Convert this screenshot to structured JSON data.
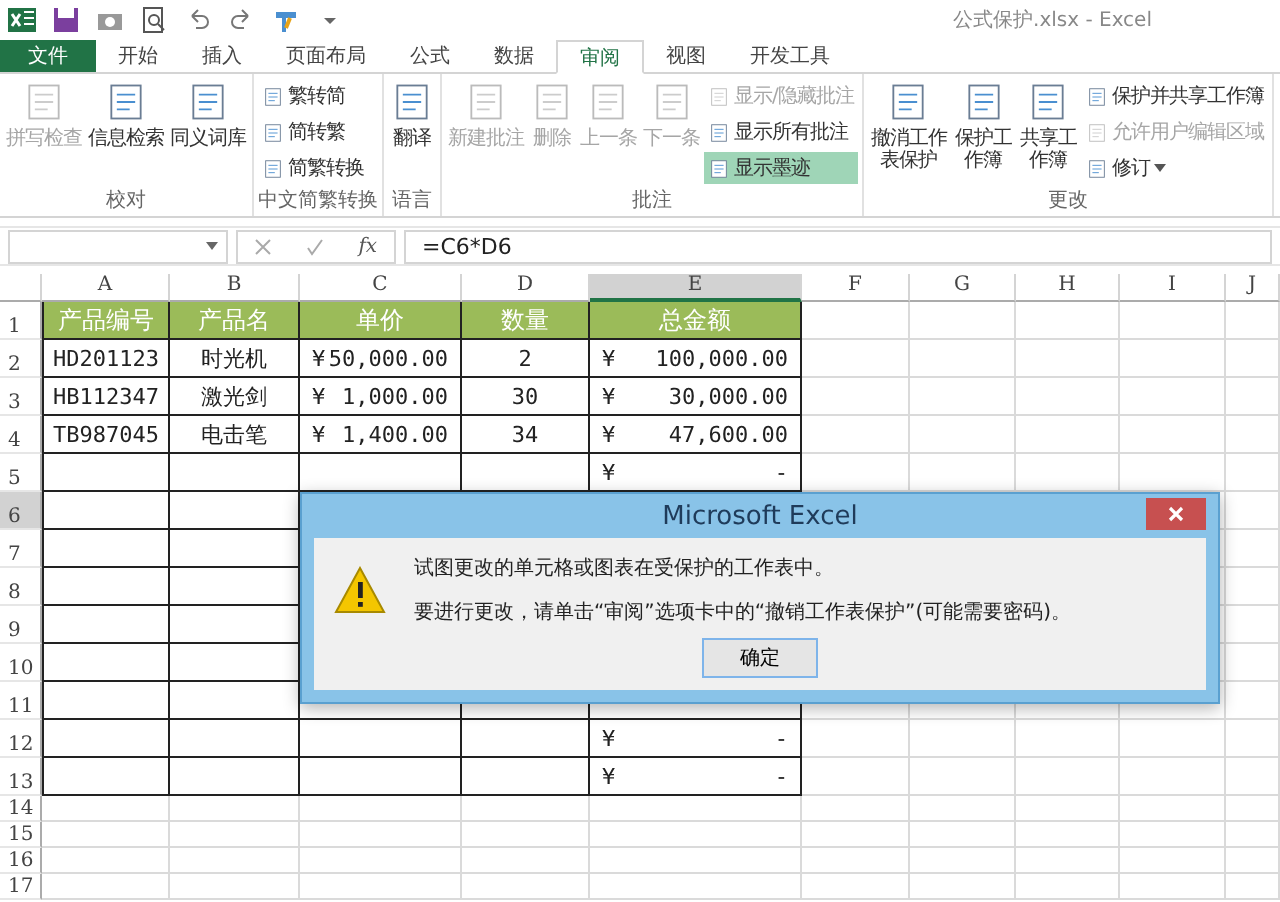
{
  "window": {
    "title": "公式保护.xlsx - Excel"
  },
  "tabs": [
    {
      "label": "文件",
      "kind": "file",
      "selected": false
    },
    {
      "label": "开始",
      "kind": "tab",
      "selected": false
    },
    {
      "label": "插入",
      "kind": "tab",
      "selected": false
    },
    {
      "label": "页面布局",
      "kind": "tab",
      "selected": false
    },
    {
      "label": "公式",
      "kind": "tab",
      "selected": false
    },
    {
      "label": "数据",
      "kind": "tab",
      "selected": false
    },
    {
      "label": "审阅",
      "kind": "tab",
      "selected": true
    },
    {
      "label": "视图",
      "kind": "tab",
      "selected": false
    },
    {
      "label": "开发工具",
      "kind": "tab",
      "selected": false
    }
  ],
  "ribbon": {
    "groups": [
      {
        "label": "校对",
        "buttons": [
          {
            "kind": "large",
            "label": "拼写检查",
            "disabled": true
          },
          {
            "kind": "large",
            "label": "信息检索",
            "disabled": false
          },
          {
            "kind": "large",
            "label": "同义词库",
            "disabled": false
          }
        ]
      },
      {
        "label": "中文简繁转换",
        "buttons": [
          {
            "kind": "small",
            "label": "繁转简",
            "disabled": false,
            "on": false,
            "dropdown": false
          },
          {
            "kind": "small",
            "label": "简转繁",
            "disabled": false,
            "on": false,
            "dropdown": false
          },
          {
            "kind": "small",
            "label": "简繁转换",
            "disabled": false,
            "on": false,
            "dropdown": false
          }
        ]
      },
      {
        "label": "语言",
        "buttons": [
          {
            "kind": "large",
            "label": "翻译",
            "disabled": false
          }
        ]
      },
      {
        "label": "批注",
        "buttons": [
          {
            "kind": "large",
            "label": "新建批注",
            "disabled": true
          },
          {
            "kind": "large",
            "label": "删除",
            "disabled": true
          },
          {
            "kind": "large",
            "label": "上一条",
            "disabled": true
          },
          {
            "kind": "large",
            "label": "下一条",
            "disabled": true
          },
          {
            "kind": "small",
            "label": "显示/隐藏批注",
            "disabled": true,
            "on": false,
            "dropdown": false
          },
          {
            "kind": "small",
            "label": "显示所有批注",
            "disabled": false,
            "on": false,
            "dropdown": false
          },
          {
            "kind": "small",
            "label": "显示墨迹",
            "disabled": false,
            "on": true,
            "dropdown": false
          }
        ]
      },
      {
        "label": "更改",
        "buttons": [
          {
            "kind": "large_wrapped",
            "label": "撤消工作表保护",
            "disabled": false
          },
          {
            "kind": "large_wrapped",
            "label": "保护工作簿",
            "disabled": false
          },
          {
            "kind": "large_wrapped",
            "label": "共享工作簿",
            "disabled": false
          },
          {
            "kind": "small",
            "label": "保护并共享工作簿",
            "disabled": false,
            "on": false,
            "dropdown": false
          },
          {
            "kind": "small",
            "label": "允许用户编辑区域",
            "disabled": true,
            "on": false,
            "dropdown": false
          },
          {
            "kind": "small",
            "label": "修订",
            "disabled": false,
            "on": false,
            "dropdown": true
          }
        ]
      }
    ]
  },
  "formula_bar": {
    "fx": "fx",
    "formula": "=C6*D6"
  },
  "sheet": {
    "columns": [
      {
        "label": "A",
        "selected": false
      },
      {
        "label": "B",
        "selected": false
      },
      {
        "label": "C",
        "selected": false
      },
      {
        "label": "D",
        "selected": false
      },
      {
        "label": "E",
        "selected": true
      },
      {
        "label": "F",
        "selected": false
      },
      {
        "label": "G",
        "selected": false
      },
      {
        "label": "H",
        "selected": false
      },
      {
        "label": "I",
        "selected": false
      },
      {
        "label": "J",
        "selected": false
      }
    ],
    "rows": [
      {
        "number": "1",
        "kind": "header",
        "selected": false,
        "cells": {
          "A": {
            "text": "产品编号"
          },
          "B": {
            "text": "产品名"
          },
          "C": {
            "text": "单价"
          },
          "D": {
            "text": "数量"
          },
          "E": {
            "text": "总金额"
          }
        }
      },
      {
        "number": "2",
        "kind": "table",
        "selected": false,
        "cells": {
          "A": {
            "text": "HD201123"
          },
          "B": {
            "text": "时光机"
          },
          "C": {
            "currency": "¥",
            "amount": "50,000.00"
          },
          "D": {
            "text": "2"
          },
          "E": {
            "currency": "¥",
            "amount": "100,000.00"
          }
        }
      },
      {
        "number": "3",
        "kind": "table",
        "selected": false,
        "cells": {
          "A": {
            "text": "HB112347"
          },
          "B": {
            "text": "激光剑"
          },
          "C": {
            "currency": "¥",
            "amount": "1,000.00"
          },
          "D": {
            "text": "30"
          },
          "E": {
            "currency": "¥",
            "amount": "30,000.00"
          }
        }
      },
      {
        "number": "4",
        "kind": "table",
        "selected": false,
        "cells": {
          "A": {
            "text": "TB987045"
          },
          "B": {
            "text": "电击笔"
          },
          "C": {
            "currency": "¥",
            "amount": "1,400.00"
          },
          "D": {
            "text": "34"
          },
          "E": {
            "currency": "¥",
            "amount": "47,600.00"
          }
        }
      },
      {
        "number": "5",
        "kind": "table",
        "selected": false,
        "cells": {
          "E": {
            "currency": "¥",
            "amount": "-"
          }
        }
      },
      {
        "number": "6",
        "kind": "table",
        "selected": true
      },
      {
        "number": "7",
        "kind": "table",
        "selected": false
      },
      {
        "number": "8",
        "kind": "table",
        "selected": false
      },
      {
        "number": "9",
        "kind": "table",
        "selected": false
      },
      {
        "number": "10",
        "kind": "table",
        "selected": false
      },
      {
        "number": "11",
        "kind": "table",
        "selected": false
      },
      {
        "number": "12",
        "kind": "table",
        "selected": false,
        "cells": {
          "E": {
            "currency": "¥",
            "amount": "-"
          }
        }
      },
      {
        "number": "13",
        "kind": "table",
        "selected": false,
        "cells": {
          "E": {
            "currency": "¥",
            "amount": "-"
          }
        }
      },
      {
        "number": "14",
        "kind": "plain",
        "selected": false
      },
      {
        "number": "15",
        "kind": "plain",
        "selected": false
      },
      {
        "number": "16",
        "kind": "plain",
        "selected": false
      },
      {
        "number": "17",
        "kind": "plain",
        "selected": false
      }
    ]
  },
  "dialog": {
    "title": "Microsoft Excel",
    "messages": [
      "试图更改的单元格或图表在受保护的工作表中。",
      "要进行更改，请单击“审阅”选项卡中的“撤销工作表保护”(可能需要密码)。"
    ],
    "buttons": [
      {
        "label": "确定"
      }
    ]
  }
}
